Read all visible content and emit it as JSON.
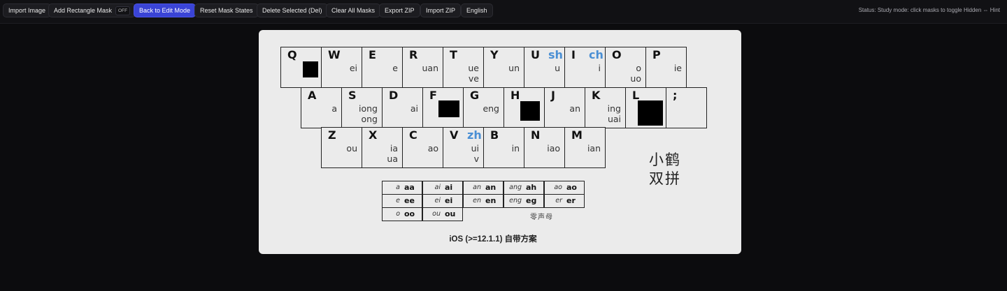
{
  "toolbar": {
    "buttons": [
      {
        "label": "Import Image"
      },
      {
        "label": "Add Rectangle Mask",
        "toggle": "OFF"
      },
      {
        "label": "Back to Edit Mode"
      },
      {
        "label": "Reset Mask States"
      },
      {
        "label": "Delete Selected (Del)"
      },
      {
        "label": "Clear All Masks"
      },
      {
        "label": "Export ZIP"
      },
      {
        "label": "Import ZIP"
      },
      {
        "label": "English"
      }
    ],
    "status": "Status: Study mode: click masks to toggle Hidden ⇔ Hint"
  },
  "image": {
    "keys": [
      {
        "letter": "Q",
        "finals": ""
      },
      {
        "letter": "W",
        "finals": "ei"
      },
      {
        "letter": "E",
        "finals": "e"
      },
      {
        "letter": "R",
        "finals": "uan"
      },
      {
        "letter": "T",
        "finals": "ue\nve"
      },
      {
        "letter": "Y",
        "finals": "un"
      },
      {
        "letter": "U",
        "initial": "sh",
        "finals": "u"
      },
      {
        "letter": "I",
        "initial": "ch",
        "finals": "i"
      },
      {
        "letter": "O",
        "finals": "o\nuo"
      },
      {
        "letter": "P",
        "finals": "ie"
      },
      {
        "letter": "A",
        "finals": "a"
      },
      {
        "letter": "S",
        "finals": "iong\nong"
      },
      {
        "letter": "D",
        "finals": "ai"
      },
      {
        "letter": "F",
        "finals": ""
      },
      {
        "letter": "G",
        "finals": "eng"
      },
      {
        "letter": "H",
        "finals": ""
      },
      {
        "letter": "J",
        "finals": "an"
      },
      {
        "letter": "K",
        "finals": "ing\nuai"
      },
      {
        "letter": "L",
        "finals": ""
      },
      {
        "letter": ";",
        "finals": ""
      },
      {
        "letter": "Z",
        "finals": "ou"
      },
      {
        "letter": "X",
        "finals": "ia\nua"
      },
      {
        "letter": "C",
        "finals": "ao"
      },
      {
        "letter": "V",
        "initial": "zh",
        "finals": "ui\nv"
      },
      {
        "letter": "B",
        "finals": "in"
      },
      {
        "letter": "N",
        "finals": "iao"
      },
      {
        "letter": "M",
        "finals": "ian"
      }
    ],
    "zero_initials": [
      {
        "i": "a",
        "c": "aa"
      },
      {
        "i": "ai",
        "c": "ai"
      },
      {
        "i": "an",
        "c": "an"
      },
      {
        "i": "ang",
        "c": "ah"
      },
      {
        "i": "ao",
        "c": "ao"
      },
      {
        "i": "e",
        "c": "ee"
      },
      {
        "i": "ei",
        "c": "ei"
      },
      {
        "i": "en",
        "c": "en"
      },
      {
        "i": "eng",
        "c": "eg"
      },
      {
        "i": "er",
        "c": "er"
      },
      {
        "i": "o",
        "c": "oo"
      },
      {
        "i": "ou",
        "c": "ou"
      }
    ],
    "zero_label": "零声母",
    "brand_line1": "小鹤",
    "brand_line2": "双拼",
    "caption": "iOS (>=12.1.1) 自带方案"
  },
  "colors": {
    "accent": "#3a44d6",
    "initial_blue": "#4a8fd4",
    "mask": "#000000"
  }
}
